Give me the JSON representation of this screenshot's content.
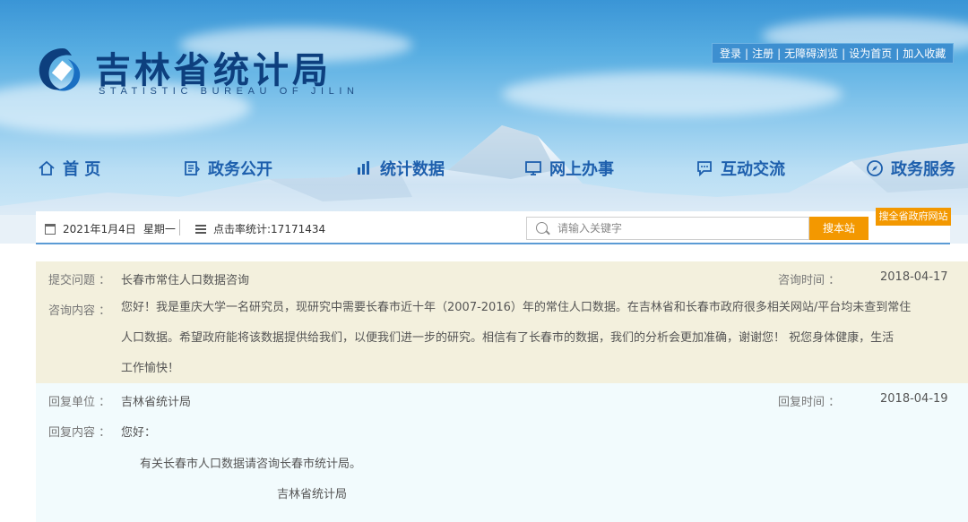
{
  "header": {
    "logo_cn": "吉林省统计局",
    "logo_en": "STATISTIC BUREAU OF JILIN",
    "toplinks": [
      "登录",
      "注册",
      "无障碍浏览",
      "设为首页",
      "加入收藏"
    ]
  },
  "nav": {
    "items": [
      {
        "label": "首 页",
        "icon": "home-icon"
      },
      {
        "label": "政务公开",
        "icon": "document-icon"
      },
      {
        "label": "统计数据",
        "icon": "bar-chart-icon"
      },
      {
        "label": "网上办事",
        "icon": "monitor-icon"
      },
      {
        "label": "互动交流",
        "icon": "chat-icon"
      },
      {
        "label": "政务服务",
        "icon": "compass-icon"
      }
    ]
  },
  "infobar": {
    "date": "2021年1月4日",
    "weekday": "星期一",
    "click_stats": "点击率统计:17171434",
    "search_placeholder": "请输入关键字",
    "search_button": "搜本站",
    "search_all_button": "搜全省政府网站"
  },
  "question": {
    "title_label": "提交问题 ：",
    "title": "长春市常住人口数据咨询",
    "time_label": "咨询时间 ：",
    "time": "2018-04-17",
    "content_label": "咨询内容 ：",
    "content_line1": "您好！我是重庆大学一名研究员，现研究中需要长春市近十年（2007-2016）年的常住人口数据。在吉林省和长春市政府很多相关网站/平台均未查到常住",
    "content_line2": "人口数据。希望政府能将该数据提供给我们，以便我们进一步的研究。相信有了长春市的数据，我们的分析会更加准确，谢谢您！ 祝您身体健康，生活",
    "content_line3": "工作愉快！"
  },
  "reply": {
    "unit_label": "回复单位 ：",
    "unit": "吉林省统计局",
    "time_label": "回复时间 ：",
    "time": "2018-04-19",
    "content_label": "回复内容 ：",
    "greeting": "您好：",
    "body": "有关长春市人口数据请咨询长春市统计局。",
    "signature": "吉林省统计局"
  },
  "colors": {
    "nav_text": "#1d5fad",
    "accent_orange": "#f39800",
    "question_bg": "#f3f0dd",
    "reply_bg": "#f2fbfd"
  }
}
